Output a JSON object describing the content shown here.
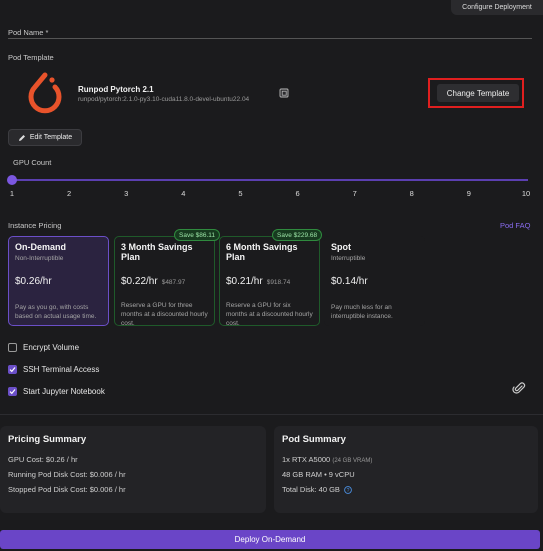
{
  "header": {
    "configure_label": "Configure Deployment"
  },
  "pod_name": {
    "label": "Pod Name *"
  },
  "template": {
    "section_label": "Pod Template",
    "name": "Runpod Pytorch 2.1",
    "image": "runpod/pytorch:2.1.0-py3.10-cuda11.8.0-devel-ubuntu22.04",
    "change_label": "Change Template",
    "edit_label": "Edit Template"
  },
  "gpu": {
    "label": "GPU Count",
    "ticks": [
      "1",
      "2",
      "3",
      "4",
      "5",
      "6",
      "7",
      "8",
      "9",
      "10"
    ],
    "selected": 1
  },
  "pricing": {
    "label": "Instance Pricing",
    "faq_label": "Pod FAQ",
    "cards": [
      {
        "title": "On-Demand",
        "sub": "Non-Interruptible",
        "price": "$0.26/hr",
        "old": "",
        "desc": "Pay as you go, with costs based on actual usage time.",
        "badge": ""
      },
      {
        "title": "3 Month Savings Plan",
        "sub": "",
        "price": "$0.22/hr",
        "old": "$487.97",
        "desc": "Reserve a GPU for three months at a discounted hourly cost.",
        "badge": "Save $86.11"
      },
      {
        "title": "6 Month Savings Plan",
        "sub": "",
        "price": "$0.21/hr",
        "old": "$918.74",
        "desc": "Reserve a GPU for six months at a discounted hourly cost.",
        "badge": "Save $229.68"
      },
      {
        "title": "Spot",
        "sub": "Interruptible",
        "price": "$0.14/hr",
        "old": "",
        "desc": "Pay much less for an interruptible instance.",
        "badge": ""
      }
    ]
  },
  "options": [
    {
      "label": "Encrypt Volume",
      "checked": false
    },
    {
      "label": "SSH Terminal Access",
      "checked": true
    },
    {
      "label": "Start Jupyter Notebook",
      "checked": true
    }
  ],
  "pricing_summary": {
    "title": "Pricing Summary",
    "lines": [
      "GPU Cost: $0.26 / hr",
      "Running Pod Disk Cost: $0.006 / hr",
      "Stopped Pod Disk Cost: $0.006 / hr"
    ]
  },
  "pod_summary": {
    "title": "Pod Summary",
    "gpu": "1x RTX A5000",
    "vram": "(24 GB VRAM)",
    "ram": "48 GB RAM • 9 vCPU",
    "disk": "Total Disk: 40 GB"
  },
  "deploy_label": "Deploy On-Demand",
  "colors": {
    "accent": "#6a45c7",
    "highlight": "#e01f1f",
    "logo": "#e8532b",
    "badge": "#2f8a3e"
  }
}
